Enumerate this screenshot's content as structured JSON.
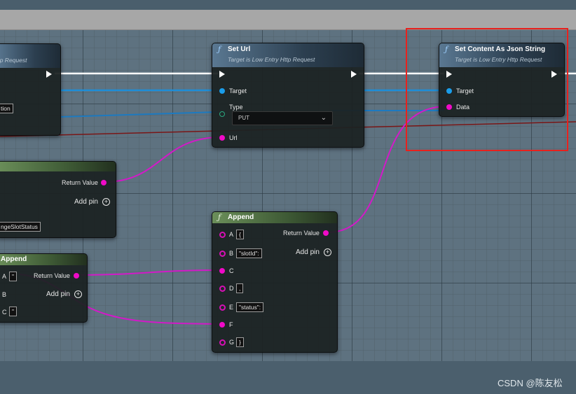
{
  "watermark": "CSDN @陈友松",
  "nodes": {
    "left_top": {
      "subtitle": "ttp Request",
      "field_value": "tion"
    },
    "set_url": {
      "title": "Set Url",
      "subtitle": "Target is Low Entry Http Request",
      "pin_target": "Target",
      "pin_type": "Type",
      "type_value": "PUT",
      "pin_url": "Url"
    },
    "set_content": {
      "title": "Set Content As Json String",
      "subtitle": "Target is Low Entry Http Request",
      "pin_target": "Target",
      "pin_data": "Data"
    },
    "left_mid": {
      "return_label": "Return Value",
      "add_pin": "Add pin",
      "field_value": "ngeSlotStatus"
    },
    "append_left": {
      "title": "Append",
      "return_label": "Return Value",
      "add_pin": "Add pin",
      "pin_a": "A",
      "pin_a_value": "\"",
      "pin_b": "B",
      "pin_c": "C",
      "pin_c_value": "\""
    },
    "append_main": {
      "title": "Append",
      "return_label": "Return Value",
      "add_pin": "Add pin",
      "pins": [
        {
          "name": "A",
          "value": "{"
        },
        {
          "name": "B",
          "value": "\"slotId\":"
        },
        {
          "name": "C",
          "value": ""
        },
        {
          "name": "D",
          "value": ","
        },
        {
          "name": "E",
          "value": "\"status\":"
        },
        {
          "name": "F",
          "value": ""
        },
        {
          "name": "G",
          "value": "}"
        }
      ]
    }
  },
  "colors": {
    "exec_wire": "#ffffff",
    "object_wire": "#1a9dea",
    "string_wire": "#d21ac8",
    "selection": "#e8211d"
  }
}
